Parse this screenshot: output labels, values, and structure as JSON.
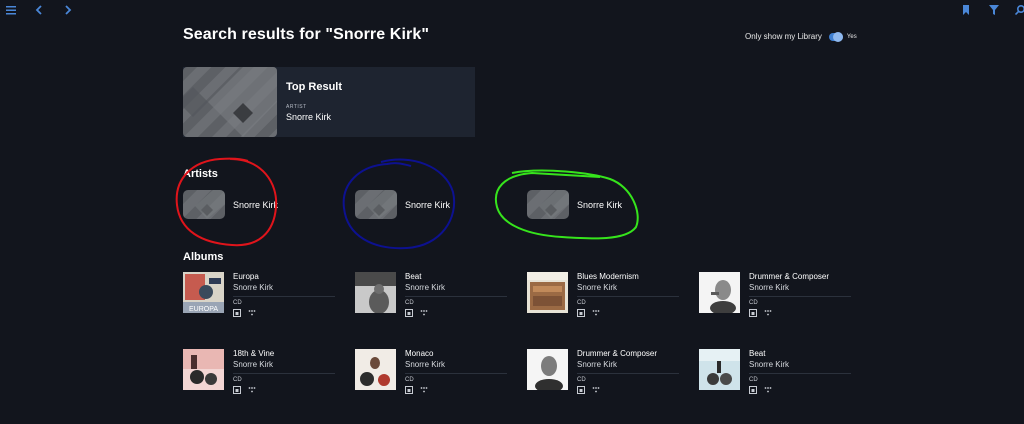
{
  "toolbar": {
    "menu_icon": "hamburger-menu-icon",
    "back_icon": "chevron-left-icon",
    "forward_icon": "chevron-right-icon",
    "bookmark_icon": "bookmark-icon",
    "filter_icon": "filter-icon",
    "search_icon": "search-icon"
  },
  "page": {
    "title": "Search results for \"Snorre Kirk\"",
    "library_toggle": {
      "label": "Only show my Library",
      "state": "Yes",
      "on": true,
      "color": "#3f7fd1"
    }
  },
  "top_result": {
    "heading": "Top Result",
    "type": "ARTIST",
    "name": "Snorre Kirk"
  },
  "artists": {
    "title": "Artists",
    "items": [
      {
        "name": "Snorre Kirk",
        "annotation_color": "#e0141b"
      },
      {
        "name": "Snorre Kirk",
        "annotation_color": "#0d1190"
      },
      {
        "name": "Snorre Kirk",
        "annotation_color": "#36e41c"
      }
    ]
  },
  "albums": {
    "title": "Albums",
    "items": [
      {
        "title": "Europa",
        "artist": "Snorre Kirk",
        "format": "CD",
        "cover_text": "EUROPA"
      },
      {
        "title": "Beat",
        "artist": "Snorre Kirk",
        "format": "CD"
      },
      {
        "title": "Blues Modernism",
        "artist": "Snorre Kirk",
        "format": "CD"
      },
      {
        "title": "Drummer & Composer",
        "artist": "Snorre Kirk",
        "format": "CD"
      },
      {
        "title": "18th & Vine",
        "artist": "Snorre Kirk",
        "format": "CD"
      },
      {
        "title": "Monaco",
        "artist": "Snorre Kirk",
        "format": "CD"
      },
      {
        "title": "Drummer & Composer",
        "artist": "Snorre Kirk",
        "format": "CD"
      },
      {
        "title": "Beat",
        "artist": "Snorre Kirk",
        "format": "CD"
      }
    ]
  }
}
